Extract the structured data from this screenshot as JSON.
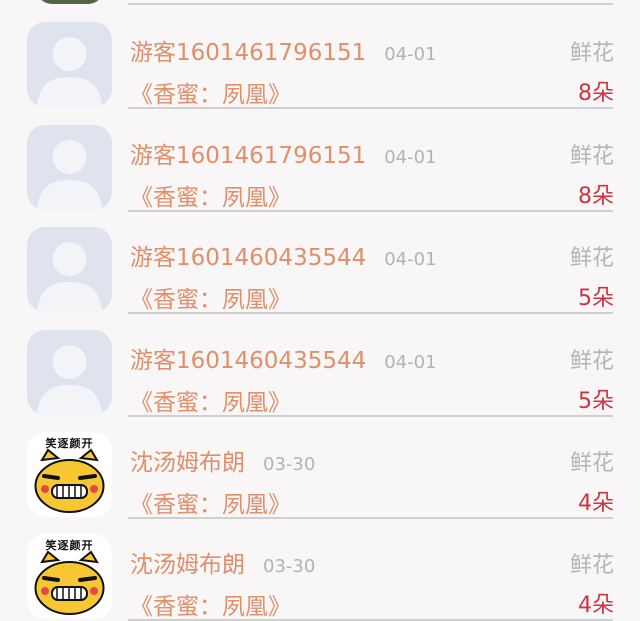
{
  "rows": [
    {
      "name": "游客1601461796151",
      "date": "04-01",
      "title": "《香蜜：夙凰》",
      "gift_type": "鲜花",
      "gift_count": "8朵",
      "avatar": "default"
    },
    {
      "name": "游客1601461796151",
      "date": "04-01",
      "title": "《香蜜：夙凰》",
      "gift_type": "鲜花",
      "gift_count": "8朵",
      "avatar": "default"
    },
    {
      "name": "游客1601460435544",
      "date": "04-01",
      "title": "《香蜜：夙凰》",
      "gift_type": "鲜花",
      "gift_count": "5朵",
      "avatar": "default"
    },
    {
      "name": "游客1601460435544",
      "date": "04-01",
      "title": "《香蜜：夙凰》",
      "gift_type": "鲜花",
      "gift_count": "5朵",
      "avatar": "default"
    },
    {
      "name": "沈汤姆布朗",
      "date": "03-30",
      "title": "《香蜜：夙凰》",
      "gift_type": "鲜花",
      "gift_count": "4朵",
      "avatar": "cat",
      "avatar_caption": "笑逐颜开"
    },
    {
      "name": "沈汤姆布朗",
      "date": "03-30",
      "title": "《香蜜：夙凰》",
      "gift_type": "鲜花",
      "gift_count": "4朵",
      "avatar": "cat",
      "avatar_caption": "笑逐颜开"
    }
  ],
  "colors": {
    "name": "#df8f69",
    "date": "#b3b3b3",
    "gift_type": "#b5b5b5",
    "gift_count": "#cf3340",
    "background": "#f8f6f7"
  }
}
